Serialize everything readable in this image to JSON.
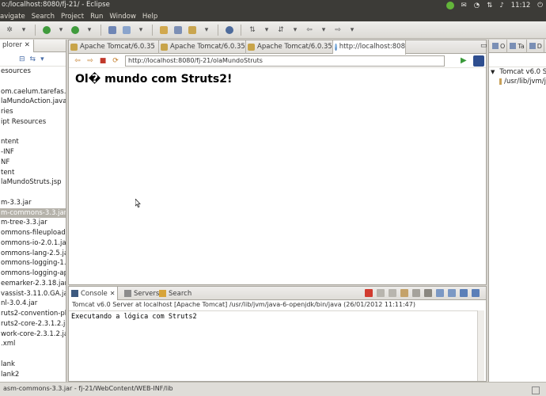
{
  "window": {
    "title": "o:/localhost:8080/fj-21/ - Eclipse"
  },
  "system": {
    "time": "11:12"
  },
  "menubar": {
    "items": [
      "avigate",
      "Search",
      "Project",
      "Run",
      "Window",
      "Help"
    ]
  },
  "left_view": {
    "tab_label": "plorer",
    "tree": [
      "esources",
      "",
      "om.caelum.tarefas.a",
      "laMundoAction.java",
      "ries",
      "ipt Resources",
      "",
      "ntent",
      "-INF",
      "NF",
      "tent",
      "laMundoStruts.jsp",
      "",
      "m-3.3.jar",
      "m-commons-3.3.jar",
      "m-tree-3.3.jar",
      "ommons-fileupload-1.",
      "ommons-io-2.0.1.jar",
      "ommons-lang-2.5.jar",
      "ommons-logging-1.1.1",
      "ommons-logging-api-1",
      "eemarker-2.3.18.jar",
      "vassist-3.11.0.GA.jar",
      "nl-3.0.4.jar",
      "ruts2-convention-plu",
      "ruts2-core-2.3.1.2.jar",
      "work-core-2.3.1.2.jar",
      ".xml",
      "",
      "lank",
      "lank2"
    ],
    "selected_index": 14
  },
  "editor": {
    "tabs": [
      {
        "label": "Apache Tomcat/6.0.35",
        "icon": "cat-icon"
      },
      {
        "label": "Apache Tomcat/6.0.35",
        "icon": "cat-icon"
      },
      {
        "label": "Apache Tomcat/6.0.35",
        "icon": "cat-icon"
      },
      {
        "label": "http://localhost:808",
        "icon": "globe-icon"
      }
    ],
    "close_glyph": "✕",
    "url": "http://localhost:8080/fj-21/olaMundoStruts",
    "page_heading": "Ol� mundo com Struts2!"
  },
  "right_view": {
    "tabs": [
      "O",
      "Ta",
      "D"
    ],
    "items": [
      "Tomcat v6.0 Se",
      "/usr/lib/jvm/j"
    ]
  },
  "console": {
    "tabs": [
      "Console",
      "Servers",
      "Search"
    ],
    "header": "Tomcat v6.0 Server at localhost [Apache Tomcat] /usr/lib/jvm/java-6-openjdk/bin/java (26/01/2012 11:11:47)",
    "output": "Executando a lógica com Struts2"
  },
  "statusbar": {
    "text": "asm-commons-3.3.jar - fj-21/WebContent/WEB-INF/lib"
  }
}
